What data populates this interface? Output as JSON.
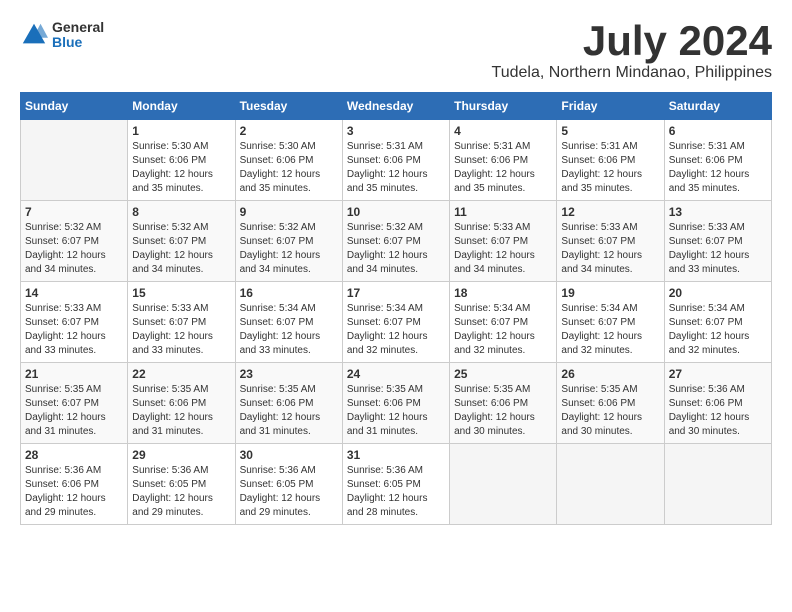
{
  "header": {
    "logo_general": "General",
    "logo_blue": "Blue",
    "month_title": "July 2024",
    "location": "Tudela, Northern Mindanao, Philippines"
  },
  "calendar": {
    "days_of_week": [
      "Sunday",
      "Monday",
      "Tuesday",
      "Wednesday",
      "Thursday",
      "Friday",
      "Saturday"
    ],
    "weeks": [
      [
        {
          "day": "",
          "empty": true
        },
        {
          "day": "1",
          "sunrise": "5:30 AM",
          "sunset": "6:06 PM",
          "daylight": "12 hours and 35 minutes."
        },
        {
          "day": "2",
          "sunrise": "5:30 AM",
          "sunset": "6:06 PM",
          "daylight": "12 hours and 35 minutes."
        },
        {
          "day": "3",
          "sunrise": "5:31 AM",
          "sunset": "6:06 PM",
          "daylight": "12 hours and 35 minutes."
        },
        {
          "day": "4",
          "sunrise": "5:31 AM",
          "sunset": "6:06 PM",
          "daylight": "12 hours and 35 minutes."
        },
        {
          "day": "5",
          "sunrise": "5:31 AM",
          "sunset": "6:06 PM",
          "daylight": "12 hours and 35 minutes."
        },
        {
          "day": "6",
          "sunrise": "5:31 AM",
          "sunset": "6:06 PM",
          "daylight": "12 hours and 35 minutes."
        }
      ],
      [
        {
          "day": "7",
          "sunrise": "5:32 AM",
          "sunset": "6:07 PM",
          "daylight": "12 hours and 34 minutes."
        },
        {
          "day": "8",
          "sunrise": "5:32 AM",
          "sunset": "6:07 PM",
          "daylight": "12 hours and 34 minutes."
        },
        {
          "day": "9",
          "sunrise": "5:32 AM",
          "sunset": "6:07 PM",
          "daylight": "12 hours and 34 minutes."
        },
        {
          "day": "10",
          "sunrise": "5:32 AM",
          "sunset": "6:07 PM",
          "daylight": "12 hours and 34 minutes."
        },
        {
          "day": "11",
          "sunrise": "5:33 AM",
          "sunset": "6:07 PM",
          "daylight": "12 hours and 34 minutes."
        },
        {
          "day": "12",
          "sunrise": "5:33 AM",
          "sunset": "6:07 PM",
          "daylight": "12 hours and 34 minutes."
        },
        {
          "day": "13",
          "sunrise": "5:33 AM",
          "sunset": "6:07 PM",
          "daylight": "12 hours and 33 minutes."
        }
      ],
      [
        {
          "day": "14",
          "sunrise": "5:33 AM",
          "sunset": "6:07 PM",
          "daylight": "12 hours and 33 minutes."
        },
        {
          "day": "15",
          "sunrise": "5:33 AM",
          "sunset": "6:07 PM",
          "daylight": "12 hours and 33 minutes."
        },
        {
          "day": "16",
          "sunrise": "5:34 AM",
          "sunset": "6:07 PM",
          "daylight": "12 hours and 33 minutes."
        },
        {
          "day": "17",
          "sunrise": "5:34 AM",
          "sunset": "6:07 PM",
          "daylight": "12 hours and 32 minutes."
        },
        {
          "day": "18",
          "sunrise": "5:34 AM",
          "sunset": "6:07 PM",
          "daylight": "12 hours and 32 minutes."
        },
        {
          "day": "19",
          "sunrise": "5:34 AM",
          "sunset": "6:07 PM",
          "daylight": "12 hours and 32 minutes."
        },
        {
          "day": "20",
          "sunrise": "5:34 AM",
          "sunset": "6:07 PM",
          "daylight": "12 hours and 32 minutes."
        }
      ],
      [
        {
          "day": "21",
          "sunrise": "5:35 AM",
          "sunset": "6:07 PM",
          "daylight": "12 hours and 31 minutes."
        },
        {
          "day": "22",
          "sunrise": "5:35 AM",
          "sunset": "6:06 PM",
          "daylight": "12 hours and 31 minutes."
        },
        {
          "day": "23",
          "sunrise": "5:35 AM",
          "sunset": "6:06 PM",
          "daylight": "12 hours and 31 minutes."
        },
        {
          "day": "24",
          "sunrise": "5:35 AM",
          "sunset": "6:06 PM",
          "daylight": "12 hours and 31 minutes."
        },
        {
          "day": "25",
          "sunrise": "5:35 AM",
          "sunset": "6:06 PM",
          "daylight": "12 hours and 30 minutes."
        },
        {
          "day": "26",
          "sunrise": "5:35 AM",
          "sunset": "6:06 PM",
          "daylight": "12 hours and 30 minutes."
        },
        {
          "day": "27",
          "sunrise": "5:36 AM",
          "sunset": "6:06 PM",
          "daylight": "12 hours and 30 minutes."
        }
      ],
      [
        {
          "day": "28",
          "sunrise": "5:36 AM",
          "sunset": "6:06 PM",
          "daylight": "12 hours and 29 minutes."
        },
        {
          "day": "29",
          "sunrise": "5:36 AM",
          "sunset": "6:05 PM",
          "daylight": "12 hours and 29 minutes."
        },
        {
          "day": "30",
          "sunrise": "5:36 AM",
          "sunset": "6:05 PM",
          "daylight": "12 hours and 29 minutes."
        },
        {
          "day": "31",
          "sunrise": "5:36 AM",
          "sunset": "6:05 PM",
          "daylight": "12 hours and 28 minutes."
        },
        {
          "day": "",
          "empty": true
        },
        {
          "day": "",
          "empty": true
        },
        {
          "day": "",
          "empty": true
        }
      ]
    ]
  }
}
